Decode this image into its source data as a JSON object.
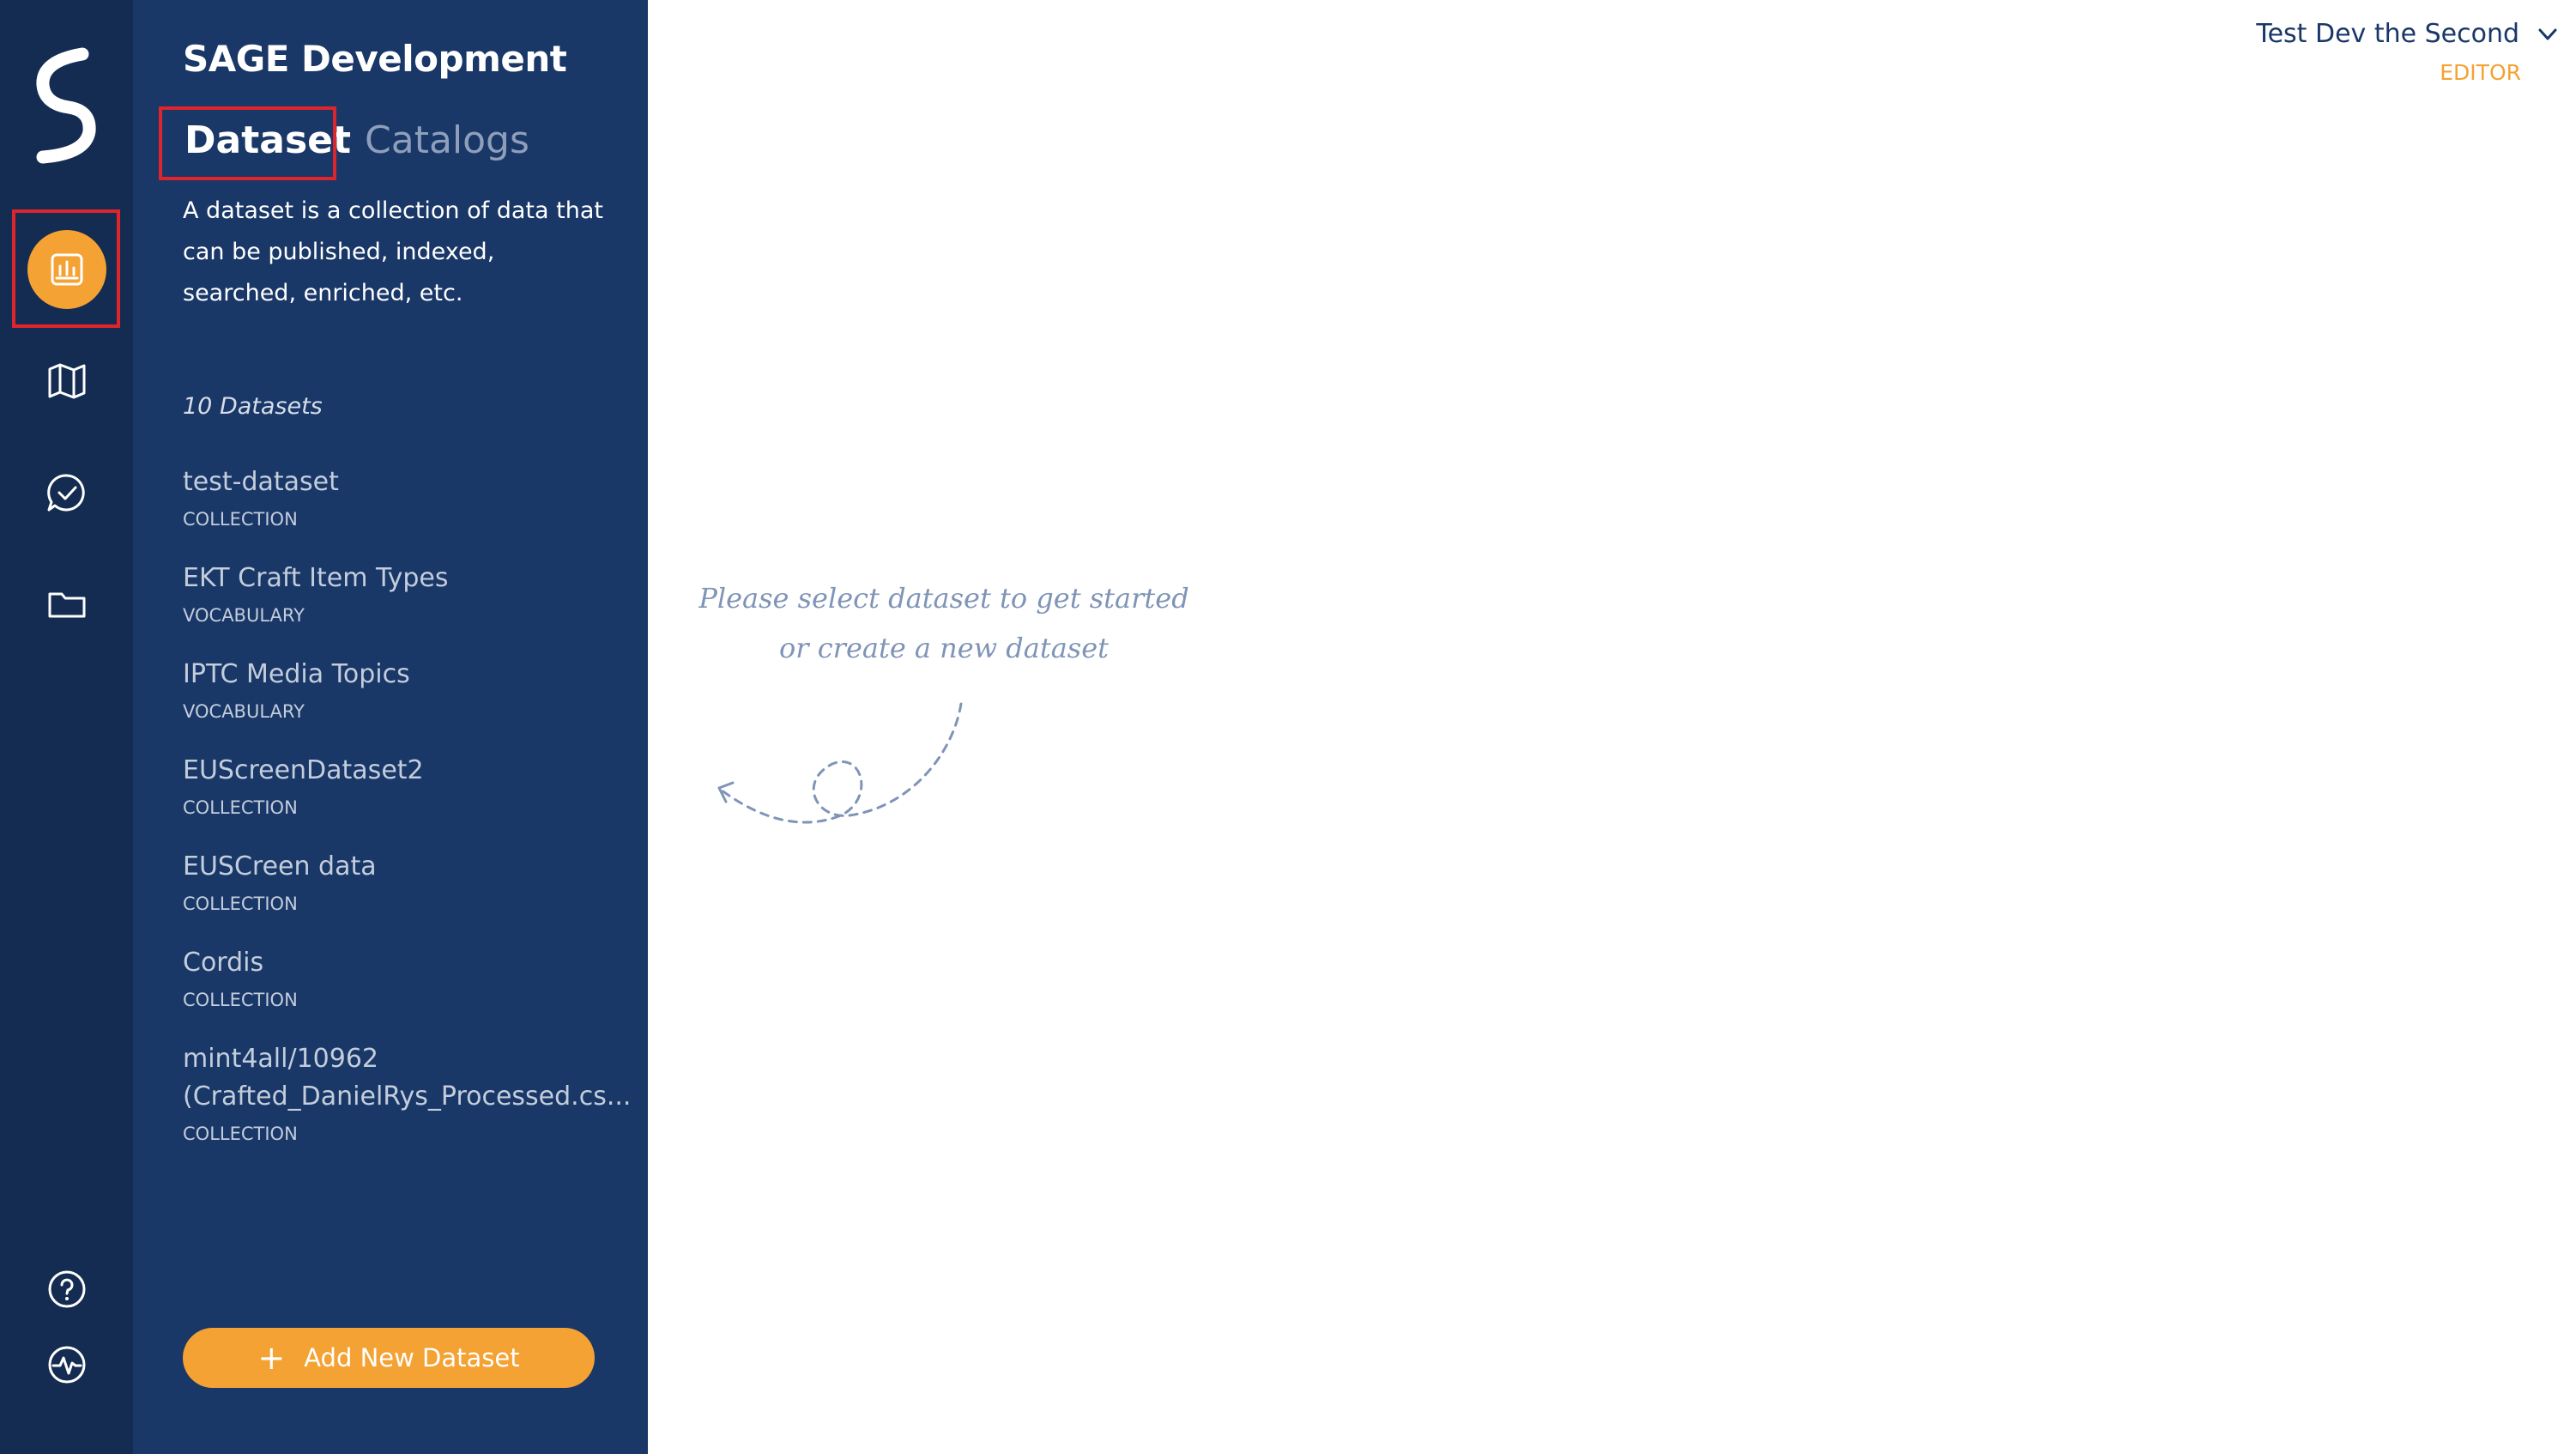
{
  "app": {
    "org_title": "SAGE Development"
  },
  "rail": {
    "items": [
      {
        "name": "datasets",
        "icon": "chart-bars-icon",
        "active": true
      },
      {
        "name": "map",
        "icon": "map-icon",
        "active": false
      },
      {
        "name": "tasks",
        "icon": "check-chat-icon",
        "active": false
      },
      {
        "name": "folders",
        "icon": "folder-icon",
        "active": false
      }
    ],
    "bottom": [
      {
        "name": "help",
        "icon": "question-icon"
      },
      {
        "name": "activity",
        "icon": "pulse-icon"
      }
    ]
  },
  "tabs": {
    "dataset": "Dataset",
    "catalogs": "Catalogs"
  },
  "panel": {
    "description": "A dataset is a collection of data that can be published, indexed, searched, enriched, etc.",
    "count_label": "10 Datasets",
    "add_button": "Add New Dataset"
  },
  "datasets": [
    {
      "name": "test-dataset",
      "type": "COLLECTION"
    },
    {
      "name": "EKT Craft Item Types",
      "type": "VOCABULARY"
    },
    {
      "name": "IPTC Media Topics",
      "type": "VOCABULARY"
    },
    {
      "name": "EUScreenDataset2",
      "type": "COLLECTION"
    },
    {
      "name": "EUSCreen data",
      "type": "COLLECTION"
    },
    {
      "name": "Cordis",
      "type": "COLLECTION"
    },
    {
      "name": "mint4all/10962 (Crafted_DanielRys_Processed.cs...",
      "type": "COLLECTION"
    }
  ],
  "user": {
    "name": "Test Dev the Second",
    "role": "EDITOR"
  },
  "main": {
    "hint": "Please select dataset to get started or create a new dataset"
  },
  "colors": {
    "rail_bg": "#142c51",
    "panel_bg": "#193767",
    "accent": "#f4a233",
    "highlight": "#e0242b"
  }
}
